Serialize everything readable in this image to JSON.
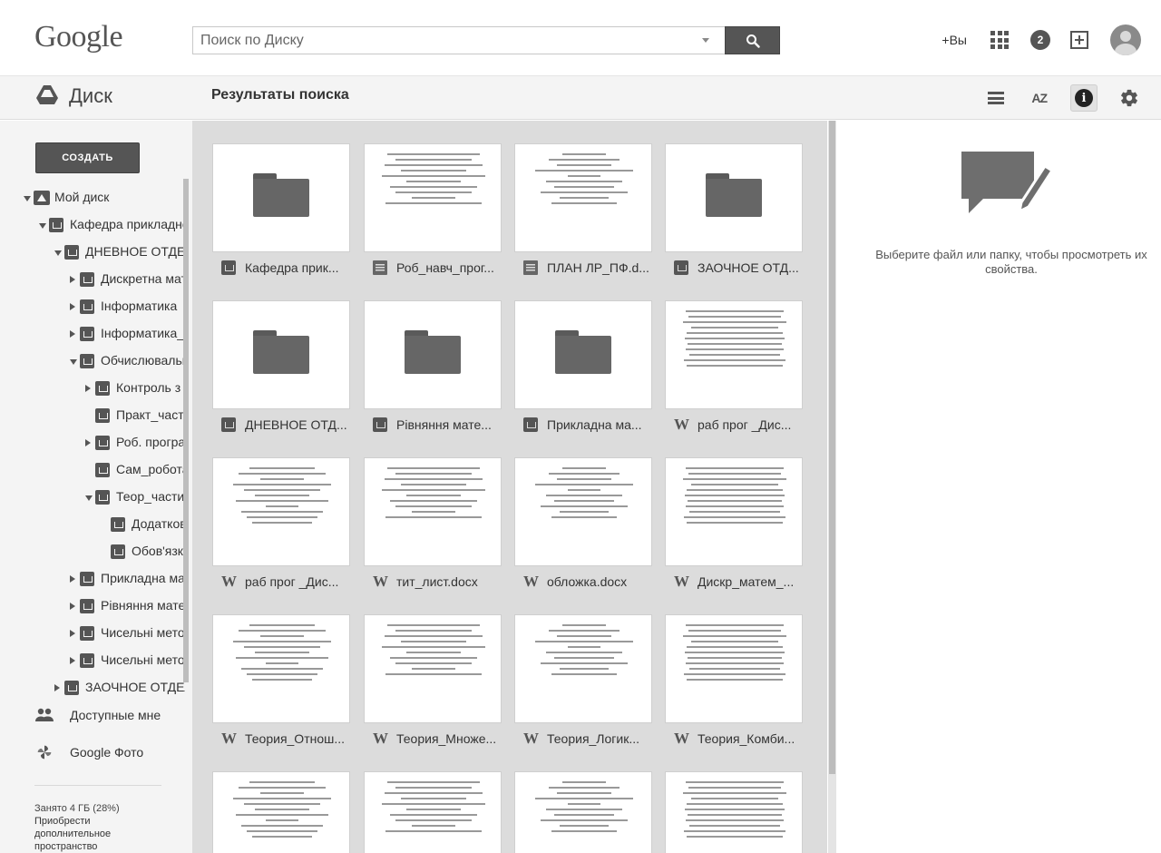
{
  "header": {
    "logo": "Google",
    "search_placeholder": "Поиск по Диску",
    "plus_you": "+Вы",
    "notifications_count": "2"
  },
  "subbar": {
    "app_name": "Диск",
    "page_title": "Результаты поиска",
    "sort_label": "AZ",
    "info_label": "i"
  },
  "sidebar": {
    "create_label": "СОЗДАТЬ",
    "tree": [
      {
        "label": "Мой диск",
        "depth": 0,
        "arrow": "down",
        "icon": "drive"
      },
      {
        "label": "Кафедра прикладної математики",
        "depth": 1,
        "arrow": "down",
        "icon": "folder"
      },
      {
        "label": "ДНЕВНОЕ ОТДЕЛЕНИЕ",
        "depth": 2,
        "arrow": "down",
        "icon": "folder"
      },
      {
        "label": "Дискретна математика",
        "depth": 3,
        "arrow": "right",
        "icon": "folder"
      },
      {
        "label": "Інформатика",
        "depth": 3,
        "arrow": "right",
        "icon": "folder"
      },
      {
        "label": "Інформатика_",
        "depth": 3,
        "arrow": "right",
        "icon": "folder"
      },
      {
        "label": "Обчислювальна",
        "depth": 3,
        "arrow": "down",
        "icon": "folder"
      },
      {
        "label": "Контроль з",
        "depth": 4,
        "arrow": "right",
        "icon": "folder"
      },
      {
        "label": "Практ_частина",
        "depth": 4,
        "arrow": "",
        "icon": "folder"
      },
      {
        "label": "Роб. програма",
        "depth": 4,
        "arrow": "right",
        "icon": "folder"
      },
      {
        "label": "Сам_робота",
        "depth": 4,
        "arrow": "",
        "icon": "folder"
      },
      {
        "label": "Теор_частина",
        "depth": 4,
        "arrow": "down",
        "icon": "folder"
      },
      {
        "label": "Додаткові",
        "depth": 5,
        "arrow": "",
        "icon": "folder"
      },
      {
        "label": "Обов'язкові",
        "depth": 5,
        "arrow": "",
        "icon": "folder"
      },
      {
        "label": "Прикладна математика",
        "depth": 3,
        "arrow": "right",
        "icon": "folder"
      },
      {
        "label": "Рівняння математичної",
        "depth": 3,
        "arrow": "right",
        "icon": "folder"
      },
      {
        "label": "Чисельні методи",
        "depth": 3,
        "arrow": "right",
        "icon": "folder"
      },
      {
        "label": "Чисельні методи_",
        "depth": 3,
        "arrow": "right",
        "icon": "folder"
      },
      {
        "label": "ЗАОЧНОЕ ОТДЕЛЕНИЕ",
        "depth": 2,
        "arrow": "right",
        "icon": "folder"
      }
    ],
    "shared_label": "Доступные мне",
    "photos_label": "Google Фото",
    "storage_used": "Занято 4 ГБ (28%)",
    "storage_buy": "Приобрести дополнительное пространство"
  },
  "grid": {
    "items": [
      {
        "name": "Кафедра прик...",
        "type": "folder"
      },
      {
        "name": "Роб_навч_прог...",
        "type": "gdoc"
      },
      {
        "name": "ПЛАН ЛР_ПФ.d...",
        "type": "gdoc"
      },
      {
        "name": "ЗАОЧНОЕ ОТД...",
        "type": "folder"
      },
      {
        "name": "ДНЕВНОЕ ОТД...",
        "type": "folder"
      },
      {
        "name": "Рівняння мате...",
        "type": "folder"
      },
      {
        "name": "Прикладна ма...",
        "type": "folder"
      },
      {
        "name": "раб прог _Дис...",
        "type": "word"
      },
      {
        "name": "раб прог _Дис...",
        "type": "word"
      },
      {
        "name": "тит_лист.docx",
        "type": "word"
      },
      {
        "name": "обложка.docx",
        "type": "word"
      },
      {
        "name": "Дискр_матем_...",
        "type": "word"
      },
      {
        "name": "Теория_Отнош...",
        "type": "word"
      },
      {
        "name": "Теория_Множе...",
        "type": "word"
      },
      {
        "name": "Теория_Логик...",
        "type": "word"
      },
      {
        "name": "Теория_Комби...",
        "type": "word"
      },
      {
        "name": "",
        "type": "doc"
      },
      {
        "name": "",
        "type": "doc"
      },
      {
        "name": "",
        "type": "doc"
      },
      {
        "name": "",
        "type": "doc"
      }
    ]
  },
  "details": {
    "message": "Выберите файл или папку, чтобы просмотреть их свойства."
  },
  "colors": {
    "accent_dark": "#555555",
    "panel_bg": "#f4f4f4",
    "grid_bg": "#dcdcdc"
  }
}
